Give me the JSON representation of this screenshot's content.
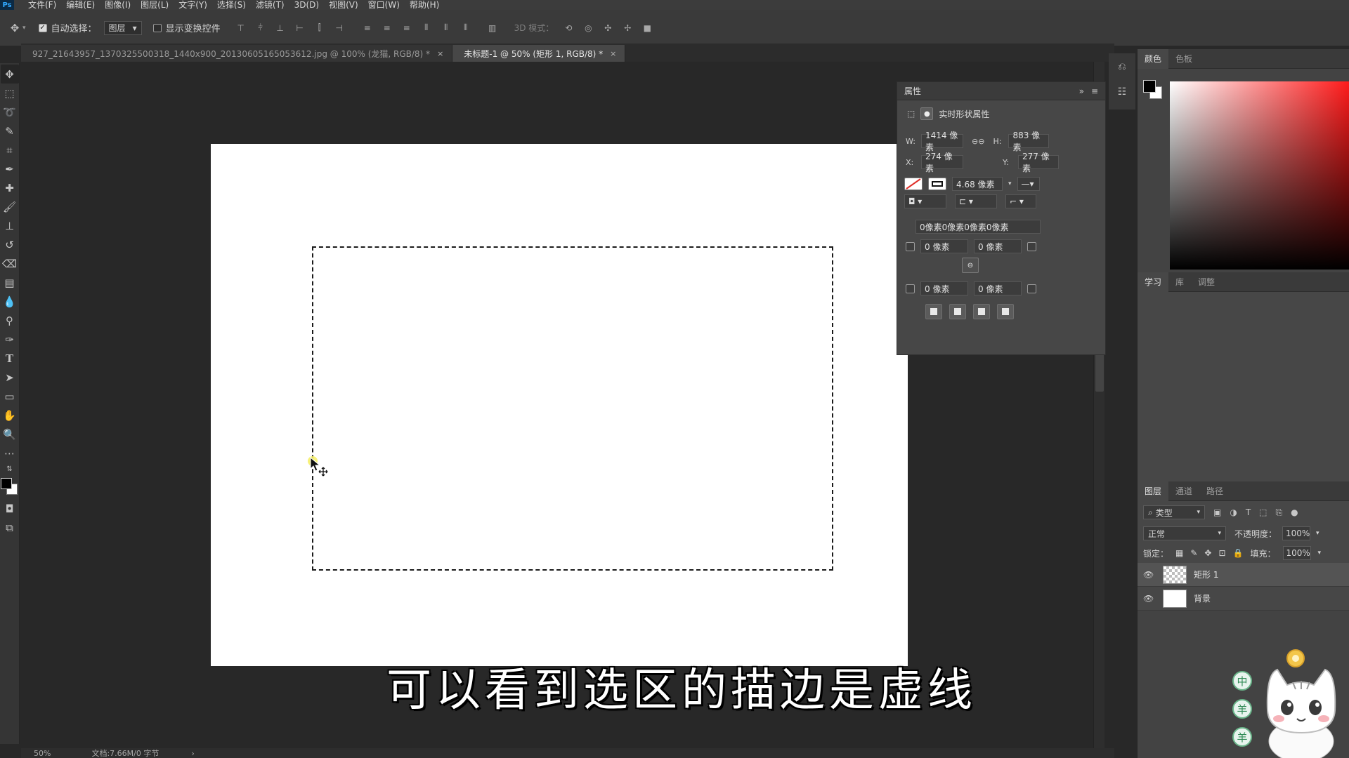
{
  "app": {
    "logo": "Ps"
  },
  "menu": [
    "文件(F)",
    "编辑(E)",
    "图像(I)",
    "图层(L)",
    "文字(Y)",
    "选择(S)",
    "滤镜(T)",
    "3D(D)",
    "视图(V)",
    "窗口(W)",
    "帮助(H)"
  ],
  "options": {
    "auto_select_label": "自动选择：",
    "auto_select_value": "图层",
    "show_transform_label": "显示变换控件",
    "threed_mode_label": "3D 模式："
  },
  "tabs": [
    {
      "title": "927_21643957_1370325500318_1440x900_20130605165053612.jpg @ 100% (龙猫, RGB/8) *",
      "close": "×"
    },
    {
      "title": "未标题-1 @ 50% (矩形 1, RGB/8) *",
      "close": "×"
    }
  ],
  "properties": {
    "title": "属性",
    "shape_label": "实时形状属性",
    "w_label": "W:",
    "w_value": "1414 像素",
    "h_label": "H:",
    "h_value": "883 像素",
    "x_label": "X:",
    "x_value": "274 像素",
    "y_label": "Y:",
    "y_value": "277 像素",
    "stroke_width": "4.68 像素",
    "corner_combined": "0像素0像素0像素0像素",
    "corner_tl": "0 像素",
    "corner_tr": "0 像素",
    "corner_bl": "0 像素",
    "corner_br": "0 像素"
  },
  "color_panel": {
    "tabs": [
      "颜色",
      "色板"
    ]
  },
  "learn_panel": {
    "tabs": [
      "学习",
      "库",
      "调整"
    ]
  },
  "layers_panel": {
    "tabs": [
      "图层",
      "通道",
      "路径"
    ],
    "filter_label": "类型",
    "blend_mode": "正常",
    "opacity_label": "不透明度：",
    "opacity_value": "100%",
    "lock_label": "锁定：",
    "fill_label": "填充：",
    "fill_value": "100%",
    "layers": [
      {
        "name": "矩形 1"
      },
      {
        "name": "背景"
      }
    ]
  },
  "subtitle": "可以看到选区的描边是虚线",
  "mascot": {
    "badge_chars": [
      "中",
      "羊",
      "羊"
    ]
  },
  "status": {
    "zoom": "50%",
    "doc_size": "文档:7.66M/0 字节",
    "arrow": "›"
  },
  "colors": {
    "accent": "#31a8ff",
    "panel_bg": "#474747",
    "workspace_bg": "#282828"
  }
}
